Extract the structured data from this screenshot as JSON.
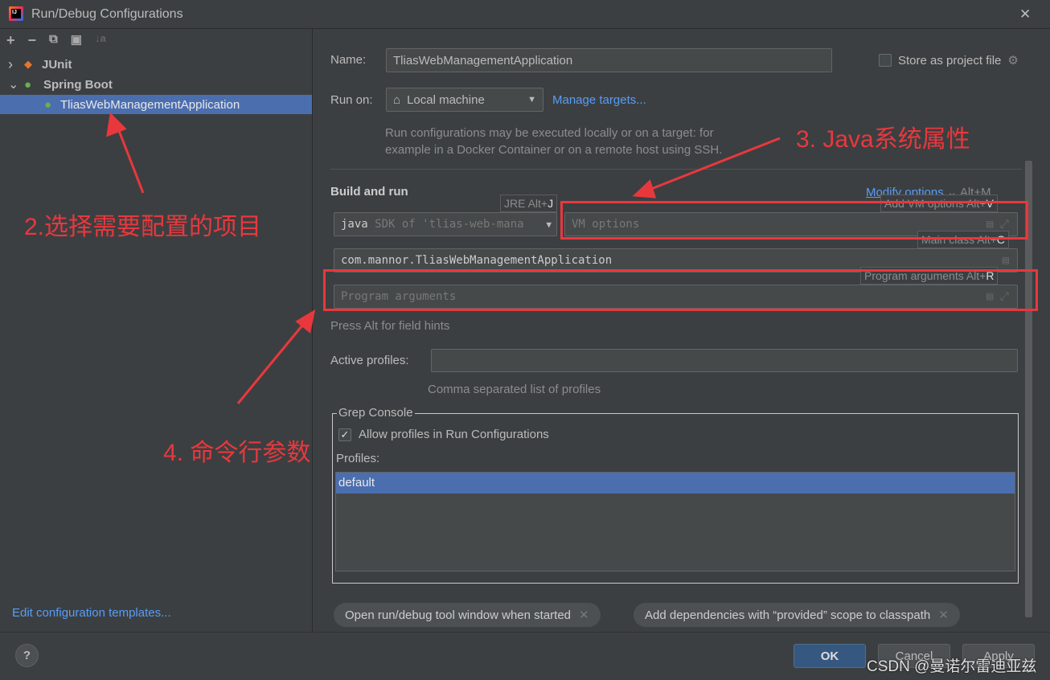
{
  "window": {
    "title": "Run/Debug Configurations",
    "close": "✕"
  },
  "toolbar": {
    "add": "+",
    "remove": "−",
    "copy": "⧉",
    "folder": "▣",
    "sort": "↓a"
  },
  "tree": {
    "items": [
      {
        "label": "JUnit",
        "arrow": "›"
      },
      {
        "label": "Spring Boot",
        "arrow": "⌄"
      },
      {
        "label": "TliasWebManagementApplication"
      }
    ]
  },
  "sidebar": {
    "edit_templates": "Edit configuration templates..."
  },
  "form": {
    "name_label": "Name:",
    "name_value": "TliasWebManagementApplication",
    "store_label": "Store as project file",
    "store_checked": false,
    "run_on_label": "Run on:",
    "run_on_value": "Local machine",
    "manage_targets": "Manage targets...",
    "run_on_help": [
      "Run configurations may be executed locally or on a target: for",
      "example in a Docker Container or on a remote host using SSH."
    ],
    "section": "Build and run",
    "modify_options": "Modify options",
    "modify_shortcut": "Alt+M",
    "jre_prefix": "java",
    "jre_value": "SDK of 'tlias-web-mana",
    "vm_placeholder": "VM options",
    "main_class": "com.mannor.TliasWebManagementApplication",
    "program_placeholder": "Program arguments",
    "press_alt": "Press Alt for field hints",
    "profiles_label": "Active profiles:",
    "profiles_value": "",
    "profiles_help": "Comma separated list of profiles",
    "grep_title": "Grep Console",
    "allow_profiles": "Allow profiles in Run Configurations",
    "allow_checked": true,
    "profiles_list_label": "Profiles:",
    "profiles_list": [
      "default"
    ]
  },
  "hints": {
    "jre": "JRE Alt+",
    "jre_key": "J",
    "vm": "Add VM options Alt+",
    "vm_key": "V",
    "main": "Main class Alt+",
    "main_key": "C",
    "prog": "Program arguments Alt+",
    "prog_key": "R"
  },
  "chips": [
    {
      "label": "Open run/debug tool window when started"
    },
    {
      "label": "Add dependencies with “provided” scope to classpath"
    }
  ],
  "buttons": {
    "help": "?",
    "ok": "OK",
    "cancel": "Cancel",
    "apply": "Apply"
  },
  "annotations": {
    "a2": "2.选择需要配置的项目",
    "a3": "3. Java系统属性",
    "a4": "4. 命令行参数"
  },
  "watermark": "CSDN @曼诺尔雷迪亚兹",
  "colors": {
    "selection": "#4b6eaf",
    "annotation": "#e8383d",
    "link": "#589df6",
    "ok": "#365880"
  }
}
